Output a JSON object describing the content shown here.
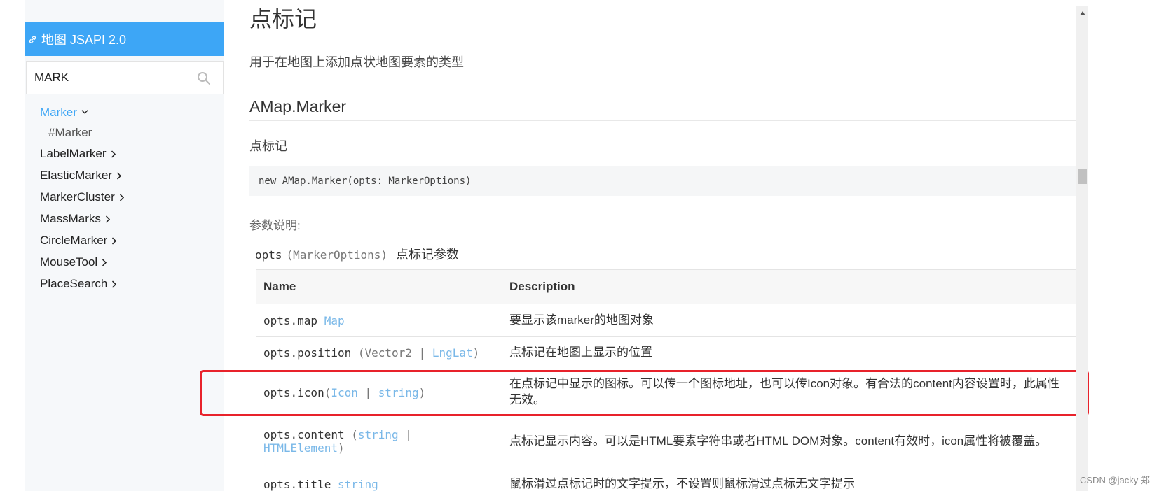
{
  "sidebar": {
    "header_title": "地图 JSAPI 2.0",
    "search_value": "MARK",
    "items": [
      {
        "label": "Marker"
      },
      {
        "label": "#Marker"
      },
      {
        "label": "LabelMarker"
      },
      {
        "label": "ElasticMarker"
      },
      {
        "label": "MarkerCluster"
      },
      {
        "label": "MassMarks"
      },
      {
        "label": "CircleMarker"
      },
      {
        "label": "MouseTool"
      },
      {
        "label": "PlaceSearch"
      }
    ]
  },
  "main": {
    "title": "点标记",
    "description": "用于在地图上添加点状地图要素的类型",
    "class_name": "AMap.Marker",
    "class_desc": "点标记",
    "constructor": "new AMap.Marker(opts: MarkerOptions)",
    "param_label": "参数说明:",
    "opts_name": "opts",
    "opts_type": "(MarkerOptions)",
    "opts_desc": "点标记参数"
  },
  "table": {
    "headers": [
      "Name",
      "Description"
    ],
    "rows": [
      {
        "name": "opts.map",
        "open": "",
        "t1": "Map",
        "sep": "",
        "t2": "",
        "close": "",
        "desc": "要显示该marker的地图对象"
      },
      {
        "name": "opts.position",
        "open": "(Vector2 | ",
        "t1": "LngLat",
        "sep": "",
        "t2": "",
        "close": ")",
        "desc": "点标记在地图上显示的位置"
      },
      {
        "name": "opts.icon",
        "open": "(",
        "t1": "Icon",
        "sep": " | ",
        "t2": "string",
        "close": ")",
        "desc": "在点标记中显示的图标。可以传一个图标地址，也可以传Icon对象。有合法的content内容设置时，此属性无效。"
      },
      {
        "name": "opts.content",
        "open": "(",
        "t1": "string",
        "sep": " | ",
        "t2": "HTMLElement",
        "close": ")",
        "desc": "点标记显示内容。可以是HTML要素字符串或者HTML DOM对象。content有效时，icon属性将被覆盖。"
      },
      {
        "name": "opts.title",
        "open": "",
        "t1": "string",
        "sep": "",
        "t2": "",
        "close": "",
        "desc": "鼠标滑过点标记时的文字提示，不设置则鼠标滑过点标无文字提示"
      }
    ]
  },
  "watermark": "CSDN @jacky 郑",
  "colors": {
    "accent": "#3da6f6",
    "highlight": "#e8222b",
    "type_link": "#7ab8e8"
  }
}
